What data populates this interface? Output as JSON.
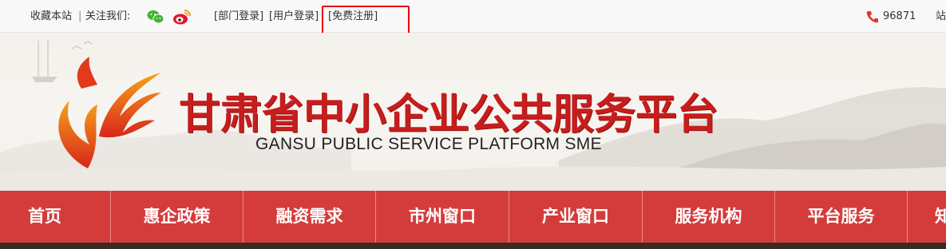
{
  "topbar": {
    "bookmark": "收藏本站",
    "divider": "|",
    "follow": "关注我们:",
    "dept_login": "[部门登录]",
    "user_login": "[用户登录]",
    "register": "[免费注册]",
    "phone": "96871",
    "site_cut": "站",
    "colors": {
      "highlight": "#e60012",
      "wechat": "#3fb52f",
      "weibo": "#e6162d",
      "phone": "#e0382a"
    }
  },
  "header": {
    "title_cn": "甘肃省中小企业公共服务平台",
    "title_en": "GANSU PUBLIC SERVICE PLATFORM SME",
    "colors": {
      "title": "#c61d1d",
      "logo": "#e23a1a"
    }
  },
  "nav": {
    "items": [
      "首页",
      "惠企政策",
      "融资需求",
      "市州窗口",
      "产业窗口",
      "服务机构",
      "平台服务",
      "知"
    ],
    "colors": {
      "bg": "#d43c3b",
      "text": "#ffffff"
    }
  }
}
